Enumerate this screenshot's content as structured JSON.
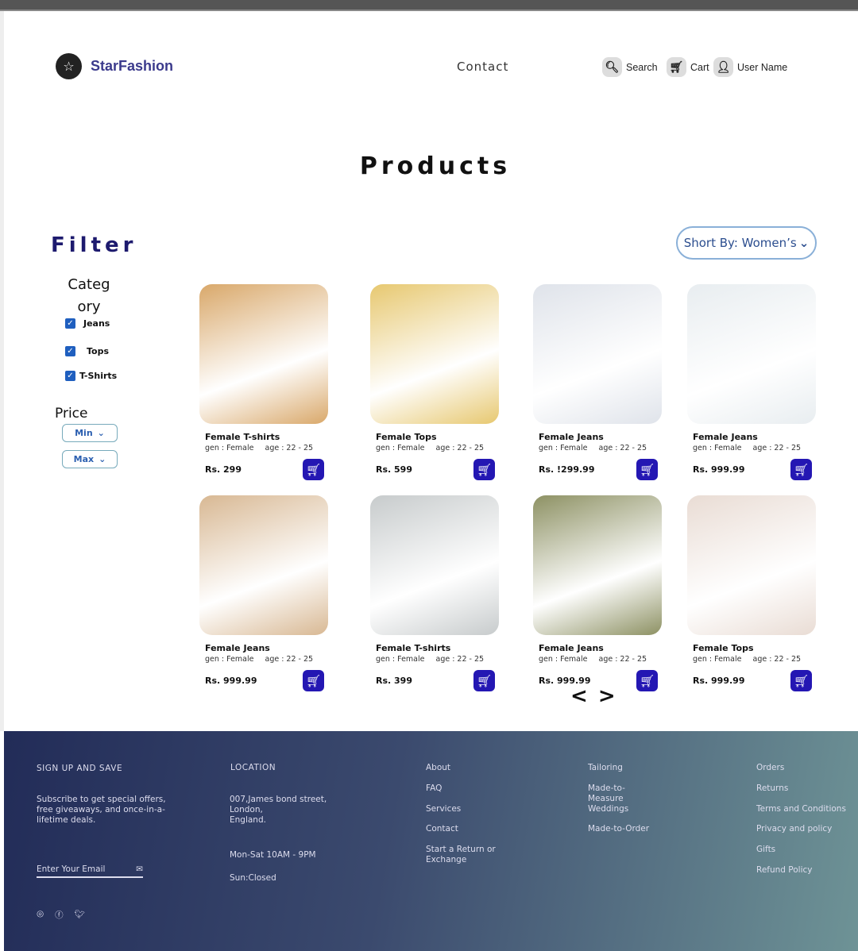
{
  "header": {
    "brand": "StarFashion",
    "contact": "Contact",
    "search": "Search",
    "cart": "Cart",
    "user": "User Name"
  },
  "page_title": "Products",
  "filter": {
    "title": "Filter",
    "category_label": "Category",
    "categories": [
      {
        "label": "Jeans",
        "checked": true
      },
      {
        "label": "Tops",
        "checked": true
      },
      {
        "label": "T-Shirts",
        "checked": true
      }
    ],
    "price_label": "Price",
    "min": "Min",
    "max": "Max"
  },
  "sort": {
    "label": "Short By: Women’s"
  },
  "products": [
    {
      "name": "Female T-shirts",
      "gen": "gen : Female",
      "age": "age : 22 - 25",
      "price": "Rs. 299",
      "color": "#d9a86a"
    },
    {
      "name": "Female Tops",
      "gen": "gen : Female",
      "age": "age : 22 - 25",
      "price": "Rs. 599",
      "color": "#e7c870"
    },
    {
      "name": "Female Jeans",
      "gen": "gen : Female",
      "age": "age : 22 - 25",
      "price": "Rs. !299.99",
      "color": "#dfe3ea"
    },
    {
      "name": "Female Jeans",
      "gen": "gen : Female",
      "age": "age : 22 - 25",
      "price": "Rs. 999.99",
      "color": "#e8edf0"
    },
    {
      "name": "Female Jeans",
      "gen": "gen : Female",
      "age": "age : 22 - 25",
      "price": "Rs. 999.99",
      "color": "#d8b893"
    },
    {
      "name": "Female T-shirts",
      "gen": "gen : Female",
      "age": "age : 22 - 25",
      "price": "Rs. 399",
      "color": "#c7cbcc"
    },
    {
      "name": "Female Jeans",
      "gen": "gen : Female",
      "age": "age : 22 - 25",
      "price": "Rs. 999.99",
      "color": "#8d9163"
    },
    {
      "name": "Female Tops",
      "gen": "gen : Female",
      "age": "age : 22 - 25",
      "price": "Rs. 999.99",
      "color": "#e9dcd4"
    }
  ],
  "pager": {
    "prev": "<",
    "next": ">"
  },
  "footer": {
    "signup_title": "SIGN UP AND SAVE",
    "signup_text": "Subscribe to get special offers, free giveaways, and once-in-a-lifetime deals.",
    "email_placeholder": "Enter Your Email",
    "location_title": "LOCATION",
    "address": [
      "007,James bond street,",
      "London,",
      "England."
    ],
    "hours": "Mon-Sat 10AM - 9PM",
    "sunday": "Sun:Closed",
    "col1": [
      "About",
      "FAQ",
      "Services",
      "Contact",
      "Start a Return or Exchange"
    ],
    "col2": [
      "Tailoring",
      "Made-to-Measure",
      "Weddings",
      "Made-to-Order"
    ],
    "col3": [
      "Orders",
      "Returns",
      "Terms and Conditions",
      "Privacy and policy",
      "Gifts",
      "Refund Policy"
    ]
  }
}
